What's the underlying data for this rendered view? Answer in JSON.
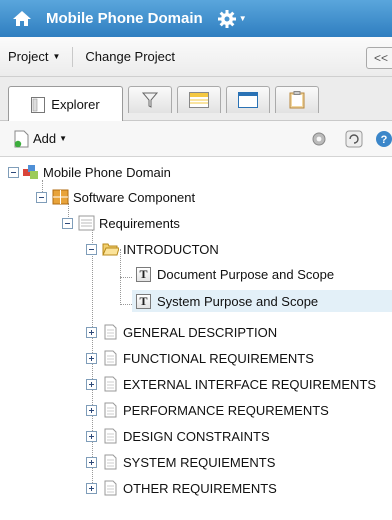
{
  "header": {
    "title": "Mobile Phone Domain",
    "home_icon": "home-icon",
    "settings_icon": "gear-icon",
    "brand_color": "#3a8ccd"
  },
  "projectbar": {
    "project_label": "Project",
    "change_project_label": "Change Project",
    "collapse_label": "<<"
  },
  "tabs": [
    {
      "label": "Explorer",
      "icon": "explorer-icon"
    },
    {
      "label": "",
      "icon": "filter-icon"
    },
    {
      "label": "",
      "icon": "table-icon"
    },
    {
      "label": "",
      "icon": "form-icon"
    },
    {
      "label": "",
      "icon": "clipboard-icon"
    }
  ],
  "toolbar": {
    "add_label": "Add"
  },
  "tree": {
    "root": "Mobile Phone Domain",
    "component": "Software Component",
    "requirements": "Requirements",
    "intro": "INTRODUCTON",
    "doc_purpose": "Document Purpose and Scope",
    "sys_purpose": "System Purpose and Scope",
    "sections": [
      "GENERAL DESCRIPTION",
      "FUNCTIONAL REQUIREMENTS",
      "EXTERNAL INTERFACE REQUIREMENTS",
      "PERFORMANCE REQUREMENTS",
      "DESIGN CONSTRAINTS",
      "SYSTEM REQUIEMENTS",
      "OTHER REQUIREMENTS"
    ]
  }
}
